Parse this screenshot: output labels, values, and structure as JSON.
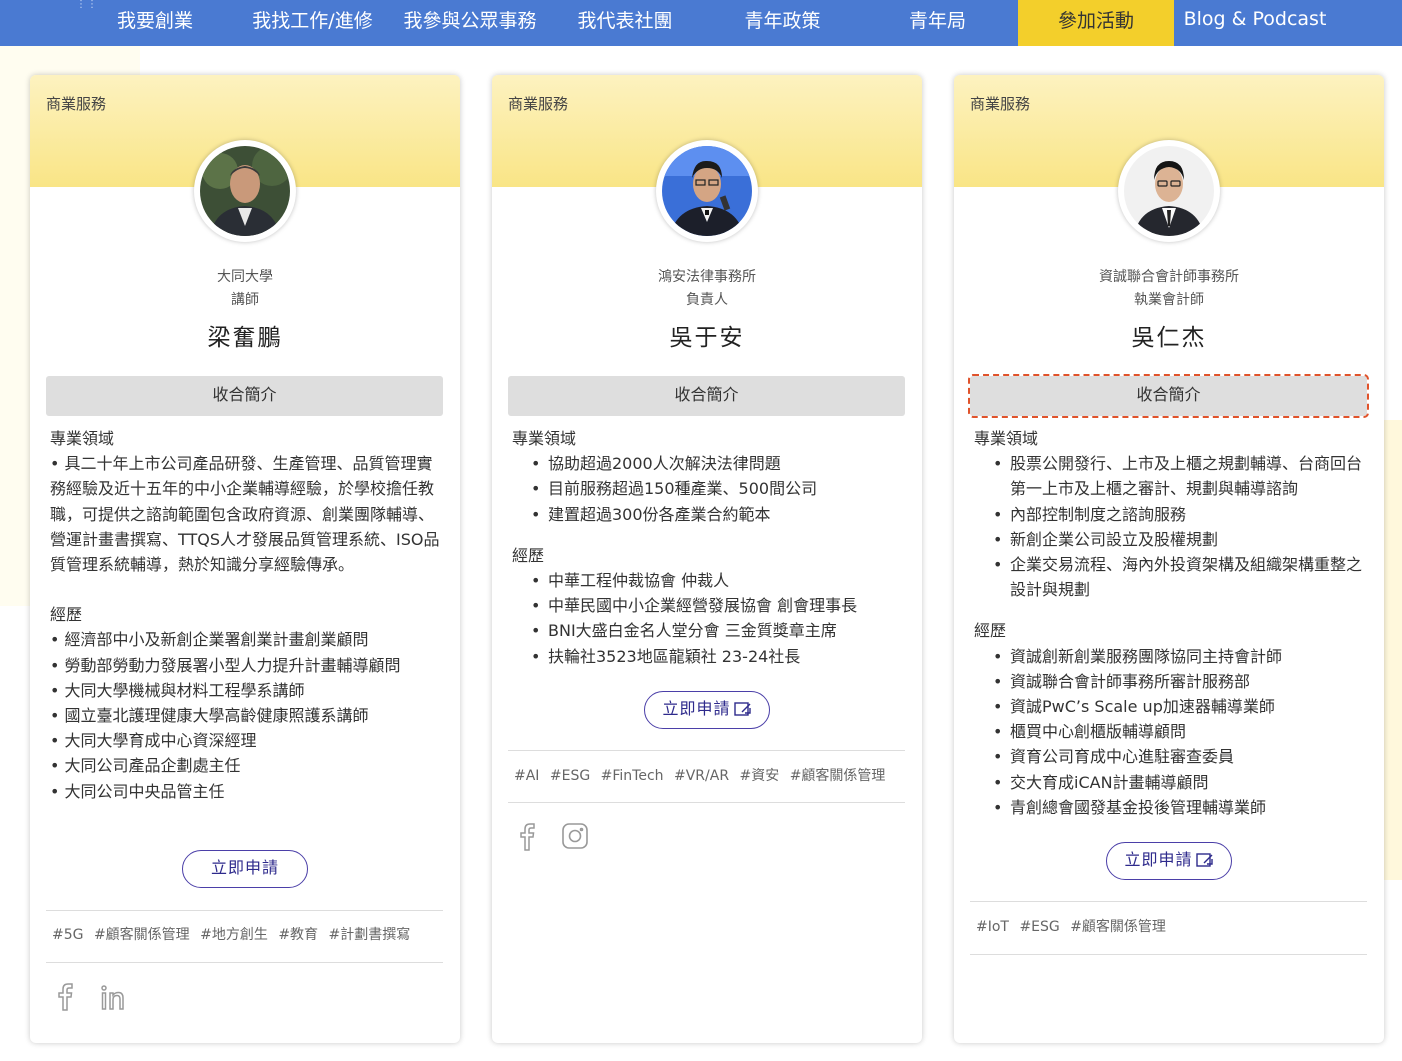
{
  "nav": {
    "items": [
      {
        "label": "我要創業"
      },
      {
        "label": "我找工作/進修"
      },
      {
        "label": "我參與公眾事務"
      },
      {
        "label": "我代表社團"
      },
      {
        "label": "青年政策"
      },
      {
        "label": "青年局"
      },
      {
        "label": "參加活動"
      },
      {
        "label": "Blog & Podcast"
      }
    ],
    "active_color": "#f3cf2b",
    "bar_color": "#4a7ad2"
  },
  "cards": [
    {
      "category": "商業服務",
      "org": "大同大學",
      "role": "講師",
      "name": "梁奮鵬",
      "collapse_label": "收合簡介",
      "expertise_title": "專業領域",
      "expertise_text": "• 具二十年上市公司產品研發、生產管理、品質管理實務經驗及近十五年的中小企業輔導經驗，於學校擔任教職，可提供之諮詢範圍包含政府資源、創業團隊輔導、營運計畫書撰寫、TTQS人才發展品質管理系統、ISO品質管理系統輔導，熱於知識分享經驗傳承。",
      "experience_title": "經歷",
      "experience": [
        "經濟部中小及新創企業署創業計畫創業顧問",
        "勞動部勞動力發展署小型人力提升計畫輔導顧問",
        "大同大學機械與材料工程學系講師",
        "國立臺北護理健康大學高齡健康照護系講師",
        "大同大學育成中心資深經理",
        "大同公司產品企劃處主任",
        "大同公司中央品管主任"
      ],
      "apply_label": "立即申請",
      "tags": [
        "#5G",
        "#顧客關係管理",
        "#地方創生",
        "#教育",
        "#計劃書撰寫"
      ],
      "social": [
        "facebook-icon",
        "linkedin-icon"
      ]
    },
    {
      "category": "商業服務",
      "org": "鴻安法律事務所",
      "role": "負責人",
      "name": "吳于安",
      "collapse_label": "收合簡介",
      "expertise_title": "專業領域",
      "expertise": [
        "協助超過2000人次解決法律問題",
        "目前服務超過150種產業、500間公司",
        "建置超過300份各產業合約範本"
      ],
      "experience_title": "經歷",
      "experience": [
        "中華工程仲裁協會 仲裁人",
        "中華民國中小企業經營發展協會 創會理事長",
        "BNI大盛白金名人堂分會 三金質獎章主席",
        "扶輪社3523地區龍穎社 23-24社長"
      ],
      "apply_label": "立即申請",
      "tags": [
        "#AI",
        "#ESG",
        "#FinTech",
        "#VR/AR",
        "#資安",
        "#顧客關係管理"
      ],
      "social": [
        "facebook-icon",
        "instagram-icon"
      ]
    },
    {
      "category": "商業服務",
      "org": "資誠聯合會計師事務所",
      "role": "執業會計師",
      "name": "吳仁杰",
      "collapse_label": "收合簡介",
      "expertise_title": "專業領域",
      "expertise": [
        "股票公開發行、上市及上櫃之規劃輔導、台商回台第一上市及上櫃之審計、規劃與輔導諮詢",
        "內部控制制度之諮詢服務",
        "新創企業公司設立及股權規劃",
        "企業交易流程、海內外投資架構及組織架構重整之設計與規劃"
      ],
      "experience_title": "經歷",
      "experience": [
        "資誠創新創業服務團隊協同主持會計師",
        "資誠聯合會計師事務所審計服務部",
        "資誠PwC’s Scale up加速器輔導業師",
        "櫃買中心創櫃版輔導顧問",
        "資育公司育成中心進駐審查委員",
        "交大育成iCAN計畫輔導顧問",
        "青創總會國發基金投後管理輔導業師"
      ],
      "apply_label": "立即申請",
      "tags": [
        "#IoT",
        "#ESG",
        "#顧客關係管理"
      ],
      "social": []
    }
  ]
}
